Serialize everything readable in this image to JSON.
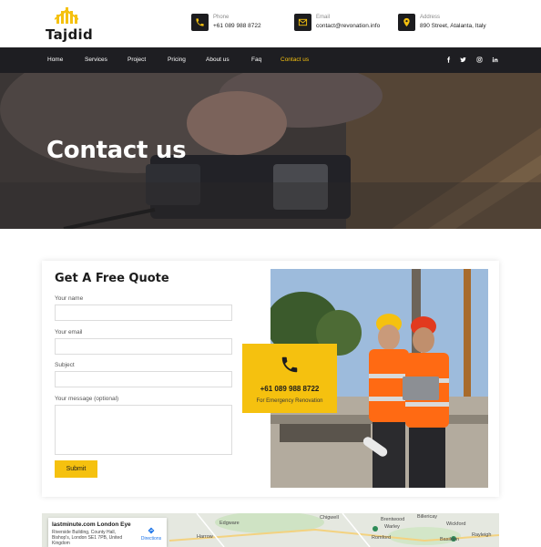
{
  "brand": {
    "name": "Tajdid"
  },
  "header": {
    "phone": {
      "label": "Phone",
      "value": "+61 089 988 8722"
    },
    "email": {
      "label": "Email",
      "value": "contact@revonation.info"
    },
    "address": {
      "label": "Address",
      "value": "890 Street, Atalanta, Italy"
    }
  },
  "nav": {
    "items": [
      {
        "label": "Home"
      },
      {
        "label": "Services"
      },
      {
        "label": "Project"
      },
      {
        "label": "Pricing"
      },
      {
        "label": "About us"
      },
      {
        "label": "Faq"
      },
      {
        "label": "Contact us",
        "active": true
      }
    ],
    "social": [
      "facebook-icon",
      "twitter-icon",
      "instagram-icon",
      "linkedin-icon"
    ]
  },
  "hero": {
    "title": "Contact us"
  },
  "quote": {
    "title": "Get A Free Quote",
    "fields": {
      "name": {
        "label": "Your name",
        "value": ""
      },
      "email": {
        "label": "Your email",
        "value": ""
      },
      "subject": {
        "label": "Subject",
        "value": ""
      },
      "message": {
        "label": "Your message (optional)",
        "value": ""
      }
    },
    "submit_label": "Submit"
  },
  "emergency": {
    "phone": "+61 089 988 8722",
    "subtitle": "For Emergency Renovation"
  },
  "map": {
    "place_title": "lastminute.com London Eye",
    "place_address": "Riverside Building, County Hall, Bishop's, London SE1 7PB, United Kingdom",
    "directions_label": "Directions",
    "labels": [
      "Edgware",
      "Chigwell",
      "Brentwood",
      "Billericay",
      "Harrow",
      "Romford",
      "Wickford",
      "Rayleigh",
      "Basildon",
      "Warley"
    ]
  },
  "colors": {
    "accent": "#f5c10f",
    "nav_bg": "#1e1e22",
    "icon_bg": "#1c1c1f"
  }
}
